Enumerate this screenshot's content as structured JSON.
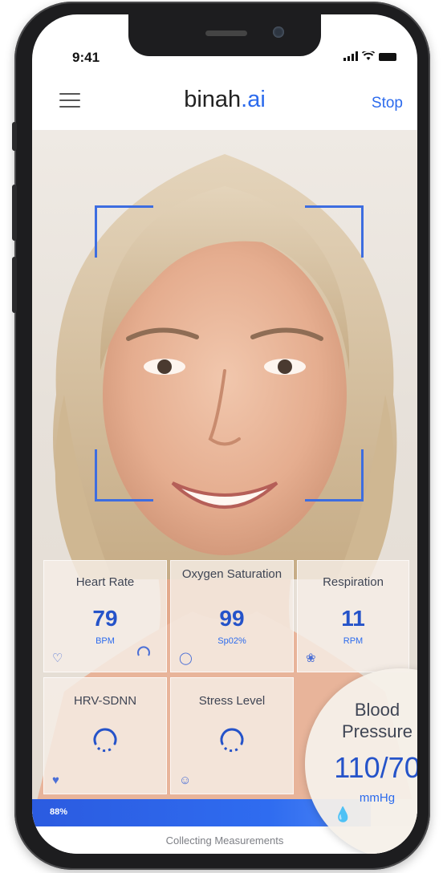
{
  "status": {
    "time": "9:41"
  },
  "header": {
    "brand_main": "binah",
    "brand_accent": ".ai",
    "stop_label": "Stop"
  },
  "metrics": [
    {
      "label": "Heart Rate",
      "value": "79",
      "unit": "BPM",
      "icon": "heart-icon"
    },
    {
      "label": "Oxygen Saturation",
      "value": "99",
      "unit": "Sp02%",
      "icon": "oxygen-icon"
    },
    {
      "label": "Respiration",
      "value": "11",
      "unit": "RPM",
      "icon": "lungs-icon"
    },
    {
      "label": "HRV-SDNN",
      "icon": "ecg-icon"
    },
    {
      "label": "Stress Level",
      "icon": "smiley-icon"
    }
  ],
  "blood_pressure": {
    "label_line1": "Blood",
    "label_line2": "Pressure",
    "value": "110/70",
    "unit": "mmHg",
    "icon": "drop-icon"
  },
  "progress": {
    "label": "88%",
    "fraction": 0.88
  },
  "footer": {
    "status_text": "Collecting Measurements"
  },
  "colors": {
    "accent": "#2c6bed",
    "value_blue": "#2553c9"
  }
}
